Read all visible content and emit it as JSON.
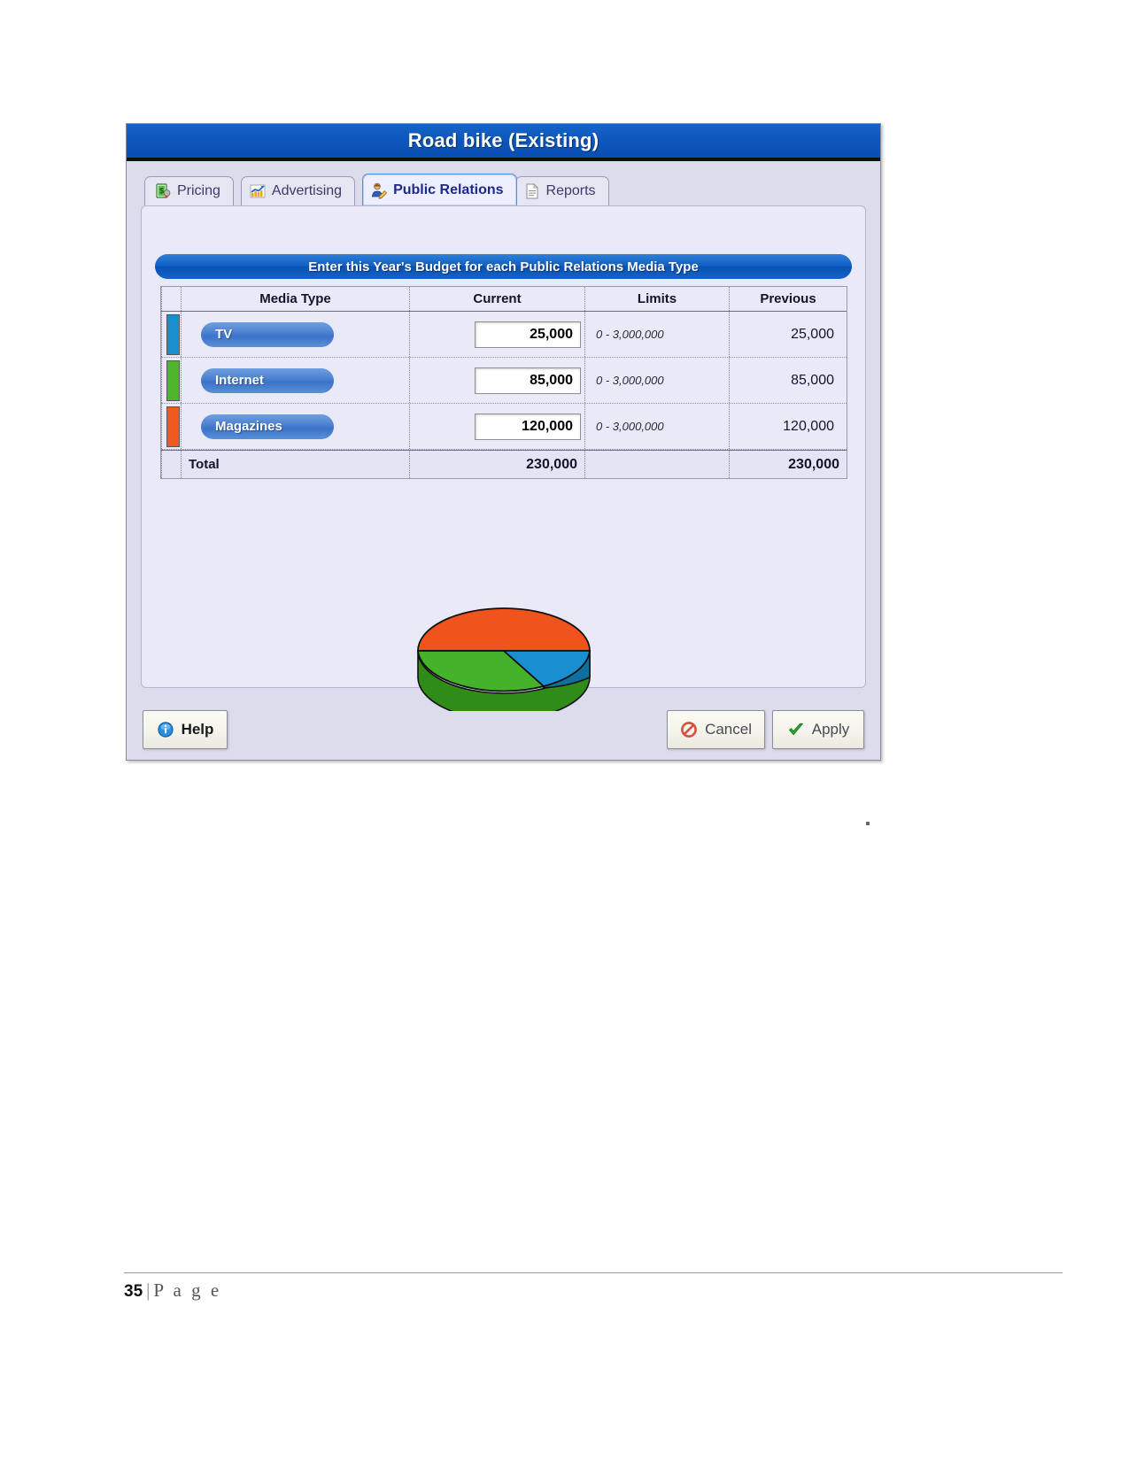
{
  "window": {
    "title": "Road bike (Existing)"
  },
  "tabs": [
    {
      "label": "Pricing",
      "icon": "price-tag-icon",
      "active": false
    },
    {
      "label": "Advertising",
      "icon": "bar-chart-trend-icon",
      "active": false
    },
    {
      "label": "Public Relations",
      "icon": "person-edit-icon",
      "active": true
    },
    {
      "label": "Reports",
      "icon": "document-icon",
      "active": false
    }
  ],
  "banner": {
    "text": "Enter this Year's Budget for each Public Relations Media Type"
  },
  "table": {
    "headers": [
      "Media Type",
      "Current",
      "Limits",
      "Previous"
    ],
    "rows": [
      {
        "media": "TV",
        "current": "25,000",
        "limits": "0 - 3,000,000",
        "previous": "25,000",
        "color": "#1a8fd0"
      },
      {
        "media": "Internet",
        "current": "85,000",
        "limits": "0 - 3,000,000",
        "previous": "85,000",
        "color": "#4fb62c"
      },
      {
        "media": "Magazines",
        "current": "120,000",
        "limits": "0 - 3,000,000",
        "previous": "120,000",
        "color": "#f05a1e"
      }
    ],
    "total": {
      "label": "Total",
      "current": "230,000",
      "previous": "230,000"
    }
  },
  "chart_data": {
    "type": "pie",
    "title": "",
    "categories": [
      "TV",
      "Internet",
      "Magazines"
    ],
    "values": [
      25000,
      85000,
      120000
    ],
    "percentages": [
      10.9,
      37.0,
      52.2
    ],
    "colors": [
      "#1a8fd0",
      "#4fb62c",
      "#f05a1e"
    ],
    "legend": "none",
    "style": "3d-pie"
  },
  "buttons": {
    "help": "Help",
    "cancel": "Cancel",
    "apply": "Apply"
  },
  "page_footer": {
    "number": "35",
    "separator": "|",
    "word": "P a g e"
  }
}
